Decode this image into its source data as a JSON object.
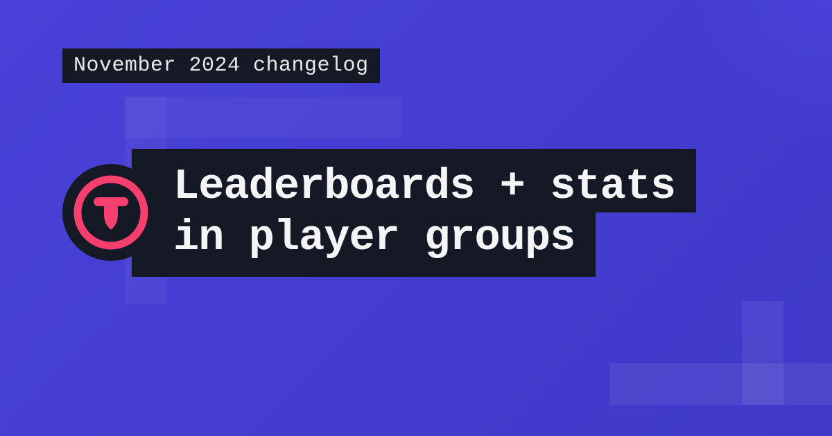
{
  "badge": {
    "label": "November 2024 changelog"
  },
  "title": {
    "line1": "Leaderboards + stats",
    "line2": "in player groups"
  },
  "colors": {
    "accent": "#f43f6f",
    "dark": "#151925",
    "background": "#4540d4"
  }
}
